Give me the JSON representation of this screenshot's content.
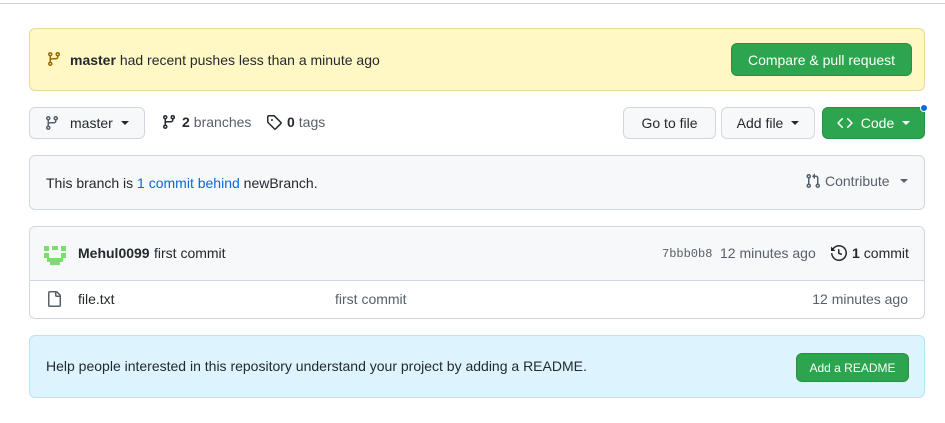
{
  "flash": {
    "branch": "master",
    "message": "had recent pushes less than a minute ago",
    "compare_label": "Compare & pull request"
  },
  "toolbar": {
    "branch_label": "master",
    "branches_count": "2",
    "branches_label": "branches",
    "tags_count": "0",
    "tags_label": "tags",
    "goto_label": "Go to file",
    "addfile_label": "Add file",
    "code_label": "Code"
  },
  "behind": {
    "prefix": "This branch is",
    "link": "1 commit behind",
    "suffix": "newBranch.",
    "contribute_label": "Contribute"
  },
  "latest_commit": {
    "author": "Mehul0099",
    "message": "first commit",
    "sha": "7bbb0b8",
    "time": "12 minutes ago",
    "count": "1",
    "count_label": "commit"
  },
  "files": [
    {
      "name": "file.txt",
      "commit_message": "first commit",
      "time": "12 minutes ago"
    }
  ],
  "readme": {
    "text": "Help people interested in this repository understand your project by adding a README.",
    "button": "Add a README"
  },
  "colors": {
    "accent_green": "#2da44e",
    "link_blue": "#0969da",
    "flash_yellow": "#fff8c5",
    "readme_blue": "#ddf4ff"
  },
  "icons": [
    "git-branch-icon",
    "tag-icon",
    "code-icon",
    "pull-request-icon",
    "history-icon",
    "file-icon",
    "avatar-identicon"
  ]
}
